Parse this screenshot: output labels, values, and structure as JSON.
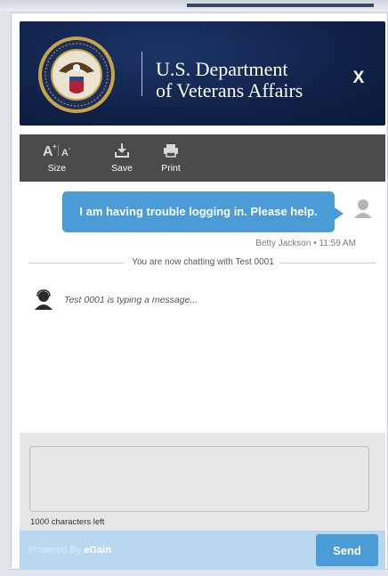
{
  "header": {
    "title_line1": "U.S. Department",
    "title_line2": "of Veterans Affairs",
    "close_label": "X"
  },
  "toolbar": {
    "size": {
      "glyph": "A+ A-",
      "label": "Size",
      "icon": "font-size-icon"
    },
    "save": {
      "glyph": "⤓",
      "label": "Save",
      "icon": "download-icon"
    },
    "print": {
      "glyph": "⎙",
      "label": "Print",
      "icon": "printer-icon"
    }
  },
  "chat": {
    "user_message": "I am having trouble logging in. Please help.",
    "user_meta": "Betty Jackson • 11:59 AM",
    "system_message": "You are now chatting with Test 0001",
    "agent_typing": "Test 0001 is typing a message..."
  },
  "compose": {
    "value": "",
    "chars_left": "1000 characters left"
  },
  "footer": {
    "powered_by": "Powered By",
    "brand": "eGain",
    "send_label": "Send"
  },
  "colors": {
    "header_bg": "#0f2147",
    "accent": "#4a9bd6",
    "toolbar_bg": "#4a4a4a",
    "footer_bg": "#b9d7ee"
  }
}
